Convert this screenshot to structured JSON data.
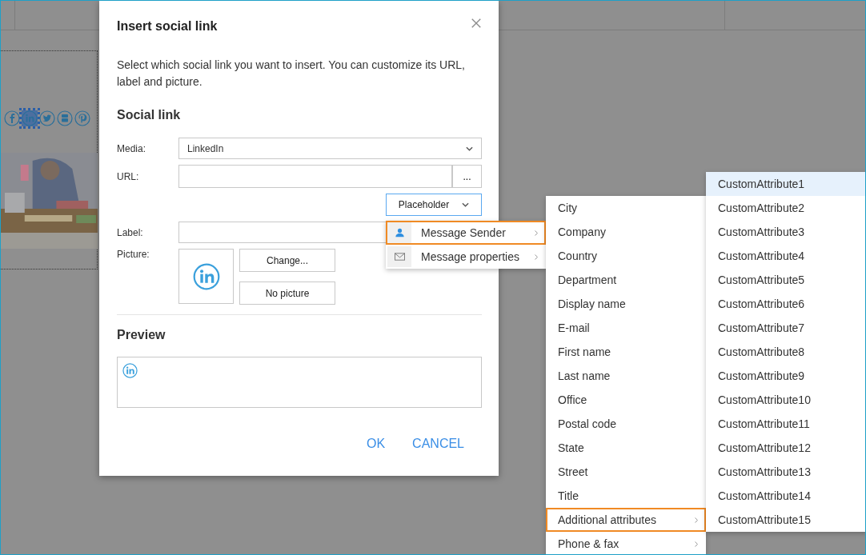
{
  "editor": {
    "social_icons": [
      {
        "kind": "facebook",
        "selected": false
      },
      {
        "kind": "linkedin",
        "selected": true
      },
      {
        "kind": "twitter",
        "selected": false
      },
      {
        "kind": "youtube",
        "selected": false
      },
      {
        "kind": "pinterest",
        "selected": false
      }
    ]
  },
  "dialog": {
    "title": "Insert social link",
    "description": "Select which social link you want to insert. You can customize its URL, label and picture.",
    "section_title": "Social link",
    "media": {
      "label": "Media:",
      "value": "LinkedIn"
    },
    "url": {
      "label": "URL:",
      "browse": "..."
    },
    "placeholder_button": "Placeholder",
    "label_field": {
      "label": "Label:"
    },
    "picture": {
      "label": "Picture:",
      "buttons": [
        "Change...",
        "No picture"
      ]
    },
    "preview_title": "Preview",
    "buttons": [
      "OK",
      "CANCEL"
    ]
  },
  "placeholder_menu": [
    {
      "label": "Message Sender",
      "kind": "person",
      "selected": true,
      "submenu": true
    },
    {
      "label": "Message properties",
      "kind": "envelope",
      "selected": false,
      "submenu": true
    }
  ],
  "sender_menu": [
    {
      "label": "City",
      "selected": false,
      "submenu": false
    },
    {
      "label": "Company",
      "selected": false,
      "submenu": false
    },
    {
      "label": "Country",
      "selected": false,
      "submenu": false
    },
    {
      "label": "Department",
      "selected": false,
      "submenu": false
    },
    {
      "label": "Display name",
      "selected": false,
      "submenu": false
    },
    {
      "label": "E-mail",
      "selected": false,
      "submenu": false
    },
    {
      "label": "First name",
      "selected": false,
      "submenu": false
    },
    {
      "label": "Last name",
      "selected": false,
      "submenu": false
    },
    {
      "label": "Office",
      "selected": false,
      "submenu": false
    },
    {
      "label": "Postal code",
      "selected": false,
      "submenu": false
    },
    {
      "label": "State",
      "selected": false,
      "submenu": false
    },
    {
      "label": "Street",
      "selected": false,
      "submenu": false
    },
    {
      "label": "Title",
      "selected": false,
      "submenu": false
    },
    {
      "label": "Additional attributes",
      "selected": true,
      "submenu": true
    },
    {
      "label": "Phone & fax",
      "selected": false,
      "submenu": true
    }
  ],
  "attribute_menu": [
    {
      "label": "CustomAttribute1",
      "selected": true
    },
    {
      "label": "CustomAttribute2",
      "selected": false
    },
    {
      "label": "CustomAttribute3",
      "selected": false
    },
    {
      "label": "CustomAttribute4",
      "selected": false
    },
    {
      "label": "CustomAttribute5",
      "selected": false
    },
    {
      "label": "CustomAttribute6",
      "selected": false
    },
    {
      "label": "CustomAttribute7",
      "selected": false
    },
    {
      "label": "CustomAttribute8",
      "selected": false
    },
    {
      "label": "CustomAttribute9",
      "selected": false
    },
    {
      "label": "CustomAttribute10",
      "selected": false
    },
    {
      "label": "CustomAttribute11",
      "selected": false
    },
    {
      "label": "CustomAttribute12",
      "selected": false
    },
    {
      "label": "CustomAttribute13",
      "selected": false
    },
    {
      "label": "CustomAttribute14",
      "selected": false
    },
    {
      "label": "CustomAttribute15",
      "selected": false
    }
  ]
}
